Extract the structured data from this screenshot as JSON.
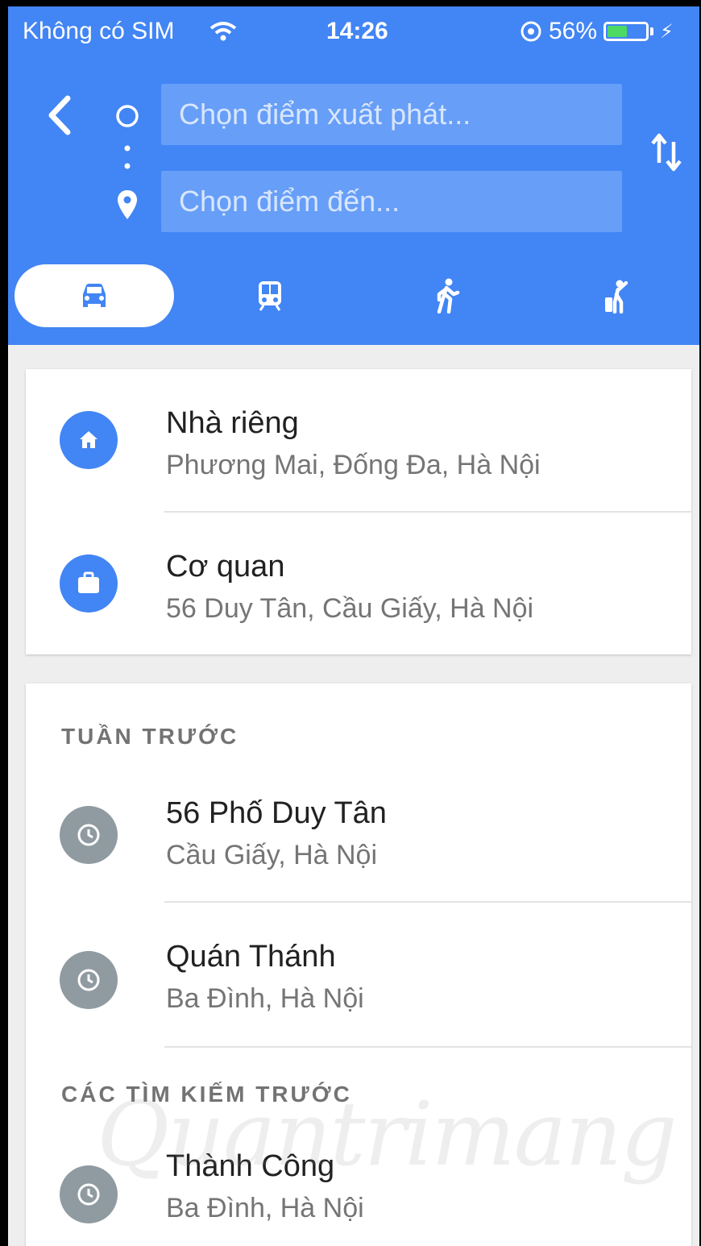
{
  "status_bar": {
    "carrier": "Không có SIM",
    "time": "14:26",
    "battery": "56%",
    "battery_level": 0.56
  },
  "route": {
    "origin_placeholder": "Chọn điểm xuất phát...",
    "destination_placeholder": "Chọn điểm đến..."
  },
  "travel_modes": [
    {
      "icon": "car-icon",
      "selected": true
    },
    {
      "icon": "transit-icon",
      "selected": false
    },
    {
      "icon": "walking-icon",
      "selected": false
    },
    {
      "icon": "ride-icon",
      "selected": false
    }
  ],
  "saved_places": [
    {
      "icon": "home-icon",
      "title": "Nhà riêng",
      "subtitle": "Phương Mai, Đống Đa, Hà Nội"
    },
    {
      "icon": "briefcase-icon",
      "title": "Cơ quan",
      "subtitle": "56 Duy Tân, Cầu Giấy, Hà Nội"
    }
  ],
  "last_week": {
    "label": "TUẦN TRƯỚC",
    "items": [
      {
        "icon": "clock-icon",
        "title": "56 Phố Duy Tân",
        "subtitle": "Cầu Giấy, Hà Nội"
      },
      {
        "icon": "clock-icon",
        "title": "Quán Thánh",
        "subtitle": "Ba Đình, Hà Nội"
      }
    ]
  },
  "previous_searches": {
    "label": "CÁC TÌM KIẾM TRƯỚC",
    "items": [
      {
        "icon": "clock-icon",
        "title": "Thành Công",
        "subtitle": "Ba Đình, Hà Nội"
      }
    ]
  },
  "watermark": "Quantrimang",
  "colors": {
    "header_blue": "#4285f4",
    "input_bg": "#679ef7",
    "history_icon_gray": "#909ba1",
    "battery_green": "#4cd964"
  }
}
